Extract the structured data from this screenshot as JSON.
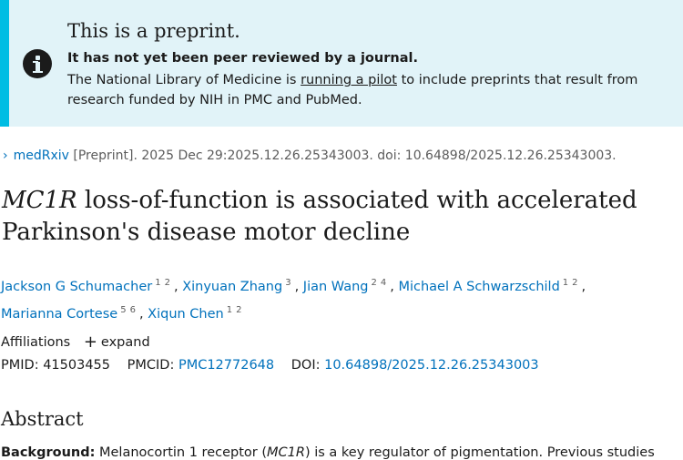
{
  "banner": {
    "title": "This is a preprint.",
    "bold_line": "It has not yet been peer reviewed by a journal.",
    "text_before": "The National Library of Medicine is ",
    "link_text": "running a pilot",
    "text_after": " to include preprints that result from research funded by NIH in PMC and PubMed."
  },
  "citation": {
    "source": "medRxiv",
    "details": "[Preprint]. 2025 Dec 29:2025.12.26.25343003. doi: 10.64898/2025.12.26.25343003."
  },
  "article": {
    "gene": "MC1R",
    "title_rest": " loss-of-function is associated with accelerated",
    "title_line2": "Parkinson's disease motor decline"
  },
  "authors": [
    {
      "name": "Jackson G Schumacher",
      "affs": [
        "1",
        "2"
      ]
    },
    {
      "name": "Xinyuan Zhang",
      "affs": [
        "3"
      ]
    },
    {
      "name": "Jian Wang",
      "affs": [
        "2",
        "4"
      ]
    },
    {
      "name": "Michael A Schwarzschild",
      "affs": [
        "1",
        "2"
      ]
    },
    {
      "name": "Marianna Cortese",
      "affs": [
        "5",
        "6"
      ]
    },
    {
      "name": "Xiqun Chen",
      "affs": [
        "1",
        "2"
      ]
    }
  ],
  "affiliations": {
    "label": "Affiliations",
    "expand": "expand"
  },
  "identifiers": {
    "pmid_label": "PMID:",
    "pmid": "41503455",
    "pmcid_label": "PMCID:",
    "pmcid": "PMC12772648",
    "doi_label": "DOI:",
    "doi": "10.64898/2025.12.26.25343003"
  },
  "abstract": {
    "heading": "Abstract",
    "label": "Background:",
    "text_before": " Melanocortin 1 receptor (",
    "gene": "MC1R",
    "text_after": ") is a key regulator of pigmentation. Previous studies"
  }
}
